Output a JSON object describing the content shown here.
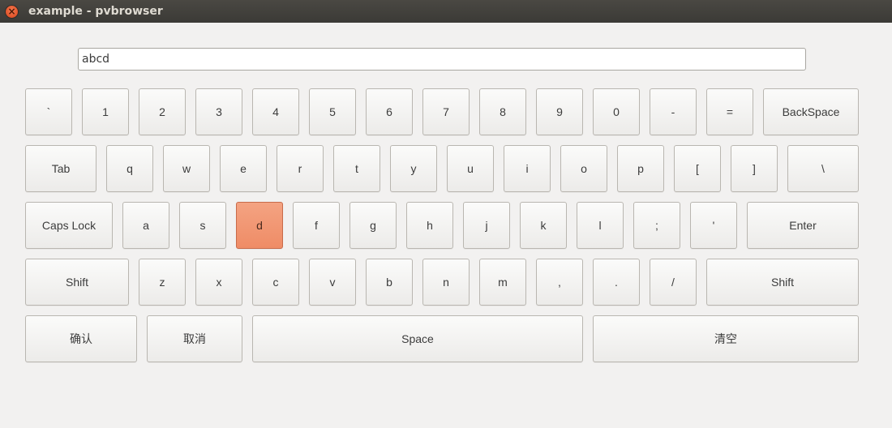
{
  "window": {
    "title": "example - pvbrowser",
    "close_glyph": "×"
  },
  "input": {
    "value": "abcd"
  },
  "keyboard": {
    "row1": [
      "`",
      "1",
      "2",
      "3",
      "4",
      "5",
      "6",
      "7",
      "8",
      "9",
      "0",
      "-",
      "=",
      "BackSpace"
    ],
    "row2": [
      "Tab",
      "q",
      "w",
      "e",
      "r",
      "t",
      "y",
      "u",
      "i",
      "o",
      "p",
      "[",
      "]",
      "\\"
    ],
    "row3": [
      "Caps Lock",
      "a",
      "s",
      "d",
      "f",
      "g",
      "h",
      "j",
      "k",
      "l",
      ";",
      "'",
      "Enter"
    ],
    "row4": [
      "Shift",
      "z",
      "x",
      "c",
      "v",
      "b",
      "n",
      "m",
      ",",
      ".",
      "/",
      "Shift"
    ],
    "row5": [
      "确认",
      "取消",
      "Space",
      "清空"
    ],
    "active_key": "d",
    "active_color": "#f29472"
  }
}
